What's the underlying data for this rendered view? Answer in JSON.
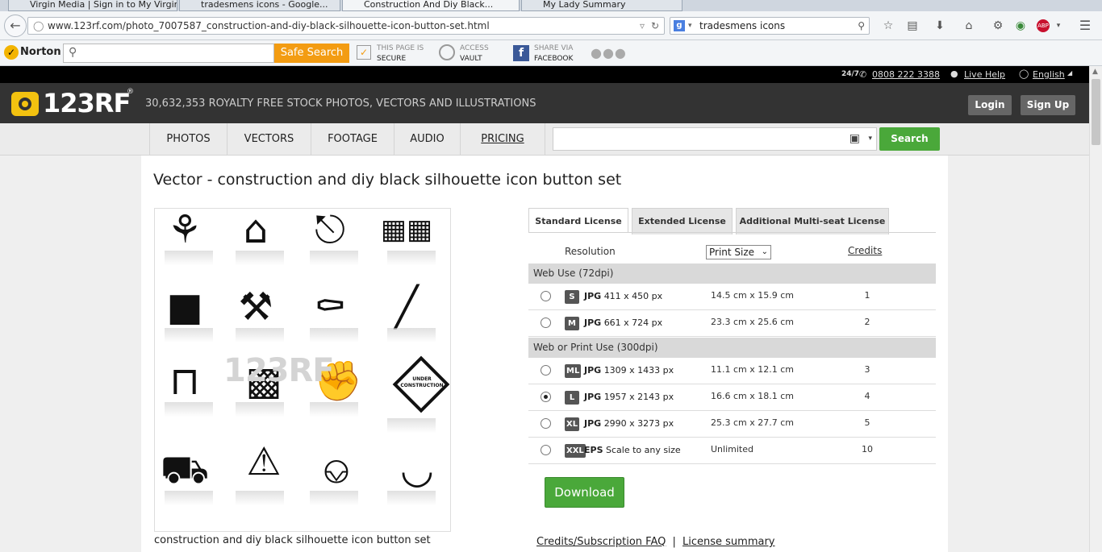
{
  "browser": {
    "tabs": [
      "Virgin Media | Sign in to My Virgin...",
      "tradesmens icons - Google...",
      "Construction And Diy Black...",
      "My Lady Summary"
    ],
    "url": "www.123rf.com/photo_7007587_construction-and-diy-black-silhouette-icon-button-set.html",
    "search_value": "tradesmens icons",
    "search_engine": "g"
  },
  "norton": {
    "brand": "Norton",
    "search_button": "Safe Search",
    "page_status_line1": "THIS PAGE IS",
    "page_status_line2": "SECURE",
    "vault_line1": "ACCESS",
    "vault_line2": "VAULT",
    "share_line1": "SHARE VIA",
    "share_line2": "FACEBOOK"
  },
  "site": {
    "support_hours": "24/7",
    "phone": "0808 222 3388",
    "live_help": "Live Help",
    "language": "English",
    "logo": "123RF",
    "tagline": "30,632,353  ROYALTY FREE STOCK PHOTOS, VECTORS AND ILLUSTRATIONS",
    "login": "Login",
    "signup": "Sign Up",
    "categories": [
      "PHOTOS",
      "VECTORS",
      "FOOTAGE",
      "AUDIO",
      "PRICING"
    ],
    "search_button": "Search"
  },
  "main": {
    "title": "Vector - construction and diy black silhouette icon button set",
    "caption": "construction and diy black silhouette icon button set",
    "watermark": "123RF",
    "sign_text": "UNDER CONSTRUCTION",
    "license_tabs": [
      "Standard License",
      "Extended License",
      "Additional Multi-seat License"
    ],
    "header": {
      "resolution": "Resolution",
      "select": "Print Size",
      "credits": "Credits"
    },
    "sections": [
      "Web Use (72dpi)",
      "Web or Print Use (300dpi)"
    ],
    "rows": [
      {
        "badge": "S",
        "fmt": "JPG",
        "dims": "411 x 450 px",
        "size": "14.5 cm x 15.9 cm",
        "credits": "1",
        "selected": false
      },
      {
        "badge": "M",
        "fmt": "JPG",
        "dims": "661 x 724 px",
        "size": "23.3 cm x 25.6 cm",
        "credits": "2",
        "selected": false
      },
      {
        "badge": "ML",
        "fmt": "JPG",
        "dims": "1309 x 1433 px",
        "size": "11.1 cm x 12.1 cm",
        "credits": "3",
        "selected": false
      },
      {
        "badge": "L",
        "fmt": "JPG",
        "dims": "1957 x 2143 px",
        "size": "16.6 cm x 18.1 cm",
        "credits": "4",
        "selected": true
      },
      {
        "badge": "XL",
        "fmt": "JPG",
        "dims": "2990 x 3273 px",
        "size": "25.3 cm x 27.7 cm",
        "credits": "5",
        "selected": false
      },
      {
        "badge": "XXL",
        "fmt": "EPS",
        "dims": "Scale to any size",
        "size": "Unlimited",
        "credits": "10",
        "selected": false
      }
    ],
    "download": "Download",
    "faq_link": "Credits/Subscription FAQ",
    "separator": "|",
    "license_summary": "License summary"
  },
  "colors": {
    "green": "#4aa83a",
    "dark": "#333333",
    "logo_yellow": "#f3c210"
  }
}
